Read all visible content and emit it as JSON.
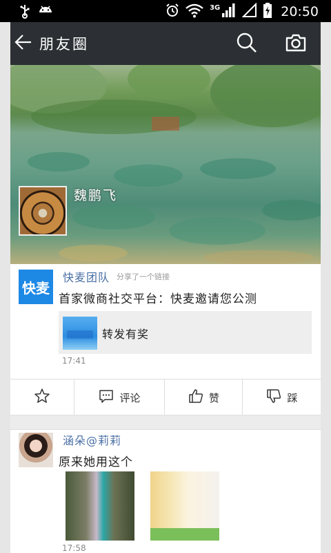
{
  "status_bar": {
    "network_type": "3G",
    "time": "20:50"
  },
  "app_bar": {
    "title": "朋友圈"
  },
  "cover": {
    "user_name": "魏鹏飞"
  },
  "posts": [
    {
      "author": "快麦团队",
      "avatar_text": "快麦",
      "share_note": "分享了一个链接",
      "text": "首家微商社交平台：快麦邀请您公测",
      "link_title": "转发有奖",
      "time": "17:41"
    },
    {
      "author": "涵朵@莉莉",
      "text": "原来她用这个",
      "time": "17:58"
    }
  ],
  "actions": {
    "comment": "评论",
    "like": "赞",
    "dislike": "踩"
  },
  "colors": {
    "app_bar": "#2c3034",
    "author_name": "#4a6fa5",
    "brand_blue": "#1e88e5"
  }
}
